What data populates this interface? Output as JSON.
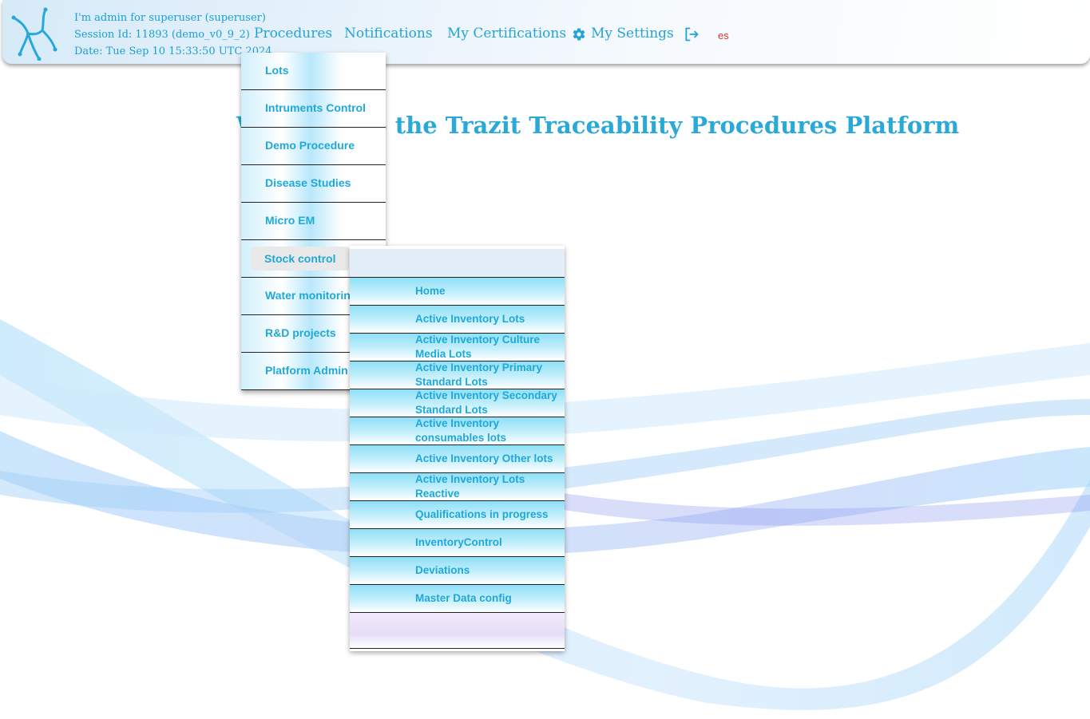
{
  "session": {
    "user_line": "I'm admin for superuser (superuser)",
    "session_line": "Session Id: 11893 (demo_v0_9_2)",
    "date_line": "Date: Tue Sep 10 15:33:50 UTC 2024"
  },
  "nav": {
    "procedures": "Procedures",
    "notifications": "Notifications",
    "certifications": "My Certifications",
    "settings": "My Settings",
    "language": "es"
  },
  "welcome_text": "Welcome to the Trazit Traceability Procedures Platform",
  "procedures_menu": [
    {
      "label": "Lots"
    },
    {
      "label": "Intruments Control"
    },
    {
      "label": "Demo Procedure"
    },
    {
      "label": "Disease Studies"
    },
    {
      "label": "Micro EM"
    },
    {
      "label": "Stock control",
      "active": true
    },
    {
      "label": "Water monitoring"
    },
    {
      "label": "R&D projects"
    },
    {
      "label": "Platform Admin"
    }
  ],
  "stock_submenu": [
    {
      "label": "Home"
    },
    {
      "label": "Active Inventory Lots"
    },
    {
      "label": "Active Inventory Culture Media Lots"
    },
    {
      "label": "Active Inventory Primary Standard Lots"
    },
    {
      "label": "Active Inventory Secondary Standard Lots"
    },
    {
      "label": "Active Inventory consumables lots"
    },
    {
      "label": "Active Inventory Other lots"
    },
    {
      "label": "Active Inventory Lots Reactive"
    },
    {
      "label": "Qualifications in progress"
    },
    {
      "label": "InventoryControl"
    },
    {
      "label": "Deviations"
    },
    {
      "label": "Master Data config"
    }
  ],
  "icons": {
    "logo": "trazit-logo",
    "settings": "gear-icon",
    "logout": "logout-icon"
  },
  "colors": {
    "accent": "#23a3d8",
    "language": "#d9342b"
  }
}
